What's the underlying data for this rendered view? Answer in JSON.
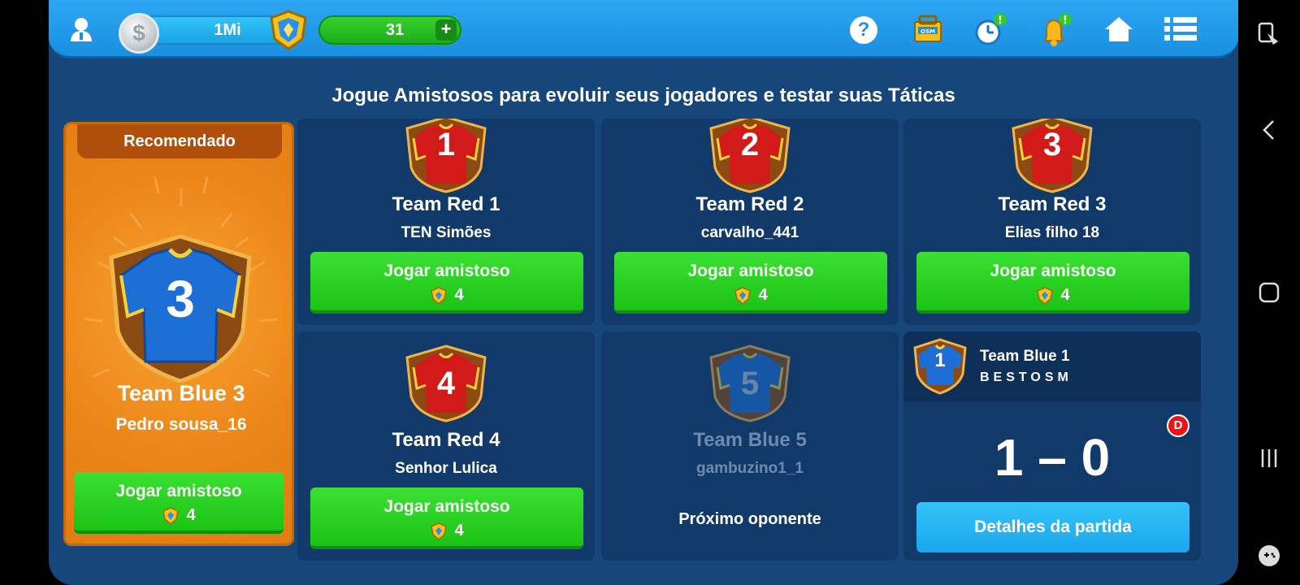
{
  "header": {
    "coins": "1Mi",
    "gems": "31",
    "gem_plus": "+",
    "coin_symbol": "$"
  },
  "headline": "Jogue Amistosos para evoluir seus jogadores e testar suas Táticas",
  "featured": {
    "ribbon": "Recomendado",
    "shirt_number": "3",
    "team": "Team Blue 3",
    "manager": "Pedro sousa_16",
    "button": "Jogar amistoso",
    "cost": "4"
  },
  "opponents": [
    {
      "shirt_number": "1",
      "team": "Team Red 1",
      "manager": "TEN Simões",
      "button": "Jogar amistoso",
      "cost": "4"
    },
    {
      "shirt_number": "2",
      "team": "Team Red 2",
      "manager": "carvalho_441",
      "button": "Jogar amistoso",
      "cost": "4"
    },
    {
      "shirt_number": "3",
      "team": "Team Red 3",
      "manager": "Elias filho 18",
      "button": "Jogar amistoso",
      "cost": "4"
    },
    {
      "shirt_number": "4",
      "team": "Team Red 4",
      "manager": "Senhor Lulica",
      "button": "Jogar amistoso",
      "cost": "4"
    },
    {
      "shirt_number": "5",
      "team": "Team Blue 5",
      "manager": "gambuzino1_1",
      "status": "Próximo oponente"
    }
  ],
  "last_result": {
    "shirt_number": "1",
    "team": "Team Blue 1",
    "manager": "BESTOSM",
    "badge": "D",
    "score": "1 – 0",
    "button": "Detalhes da partida"
  },
  "colors": {
    "background": "#17467a",
    "topbar": "#1a8fe0",
    "card": "#113a6a",
    "green_button": "#1bc314",
    "blue_button": "#19a6ef",
    "featured": "#ec8517",
    "red_shirt": "#d31a1a",
    "blue_shirt": "#1d6fd6"
  }
}
